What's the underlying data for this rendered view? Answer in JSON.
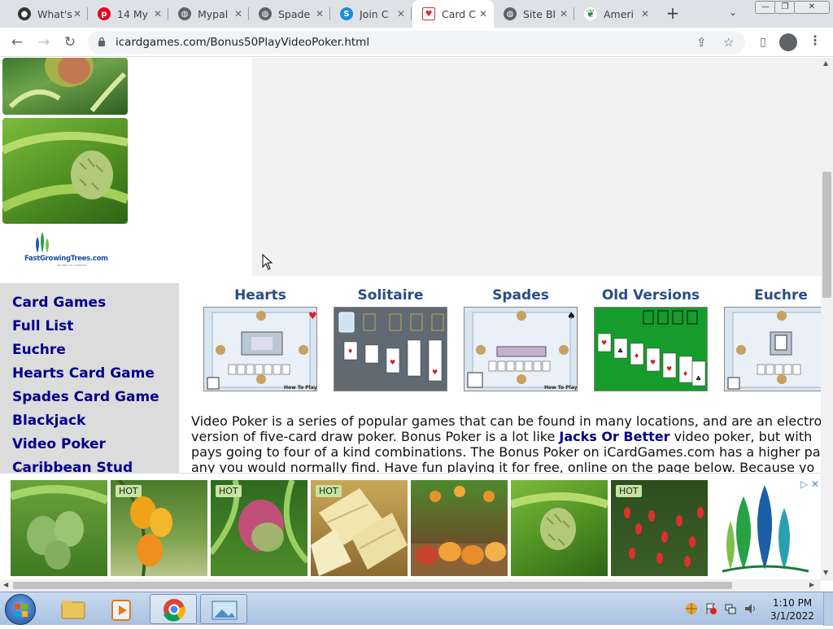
{
  "tabs": [
    {
      "title": "What's",
      "icon": "github-icon",
      "active": false
    },
    {
      "title": "14 My",
      "icon": "pinterest-icon",
      "active": false
    },
    {
      "title": "Mypal",
      "icon": "globe-icon",
      "active": false
    },
    {
      "title": "Spade",
      "icon": "globe-icon",
      "active": false
    },
    {
      "title": "Join C",
      "icon": "skype-icon",
      "active": false
    },
    {
      "title": "Card C",
      "icon": "card-icon",
      "active": true
    },
    {
      "title": "Site Bl",
      "icon": "globe-icon",
      "active": false
    },
    {
      "title": "Ameri",
      "icon": "leaf-icon",
      "active": false
    }
  ],
  "toolbar": {
    "url": "icardgames.com/Bonus50PlayVideoPoker.html"
  },
  "logo": {
    "name": "FastGrowingTrees.com",
    "tagline": "WE KEEP YOU GROWING"
  },
  "sidebar": {
    "items": [
      "Card Games",
      "Full List",
      "Euchre",
      "Hearts Card Game",
      "Spades Card Game",
      "Blackjack",
      "Video Poker",
      "Caribbean Stud"
    ]
  },
  "games": [
    {
      "title": "Hearts",
      "icon": "hearts-game-thumbnail"
    },
    {
      "title": "Solitaire",
      "icon": "solitaire-game-thumbnail"
    },
    {
      "title": "Spades",
      "icon": "spades-game-thumbnail"
    },
    {
      "title": "Old Versions",
      "icon": "old-solitaire-thumbnail"
    },
    {
      "title": "Euchre",
      "icon": "euchre-game-thumbnail"
    }
  ],
  "main": {
    "intro": {
      "line1": "Video Poker is a series of popular games that can be found in many locations, and are an electro",
      "line2_pre": "version of five-card draw poker. Bonus Poker is a lot like ",
      "line2_link": "Jacks Or Better",
      "line2_post": " video poker, but with",
      "line3": "pays going to four of a kind combinations. The Bonus Poker on iCardGames.com has a higher pa",
      "line4": "any you would normally find. Have fun playing it for free, online on the page below. Because yo"
    }
  },
  "ad": {
    "hot_label": "HOT",
    "products": [
      {
        "name": "mango-tree",
        "hot": false
      },
      {
        "name": "orange-mango-tree",
        "hot": true
      },
      {
        "name": "red-mango",
        "hot": true
      },
      {
        "name": "bamboo-shoots",
        "hot": true
      },
      {
        "name": "mango-basket",
        "hot": false
      },
      {
        "name": "sugar-apple-tree",
        "hot": false
      },
      {
        "name": "goji-berries",
        "hot": true
      }
    ],
    "adchoices_icon": "adchoices-icon"
  },
  "taskbar": {
    "time": "1:10 PM",
    "date": "3/1/2022"
  },
  "colors": {
    "link": "#00008b",
    "game_title": "#2b4d84",
    "sidebar_bg": "#dcdcdc",
    "hot_badge": "#c7e3a2"
  }
}
